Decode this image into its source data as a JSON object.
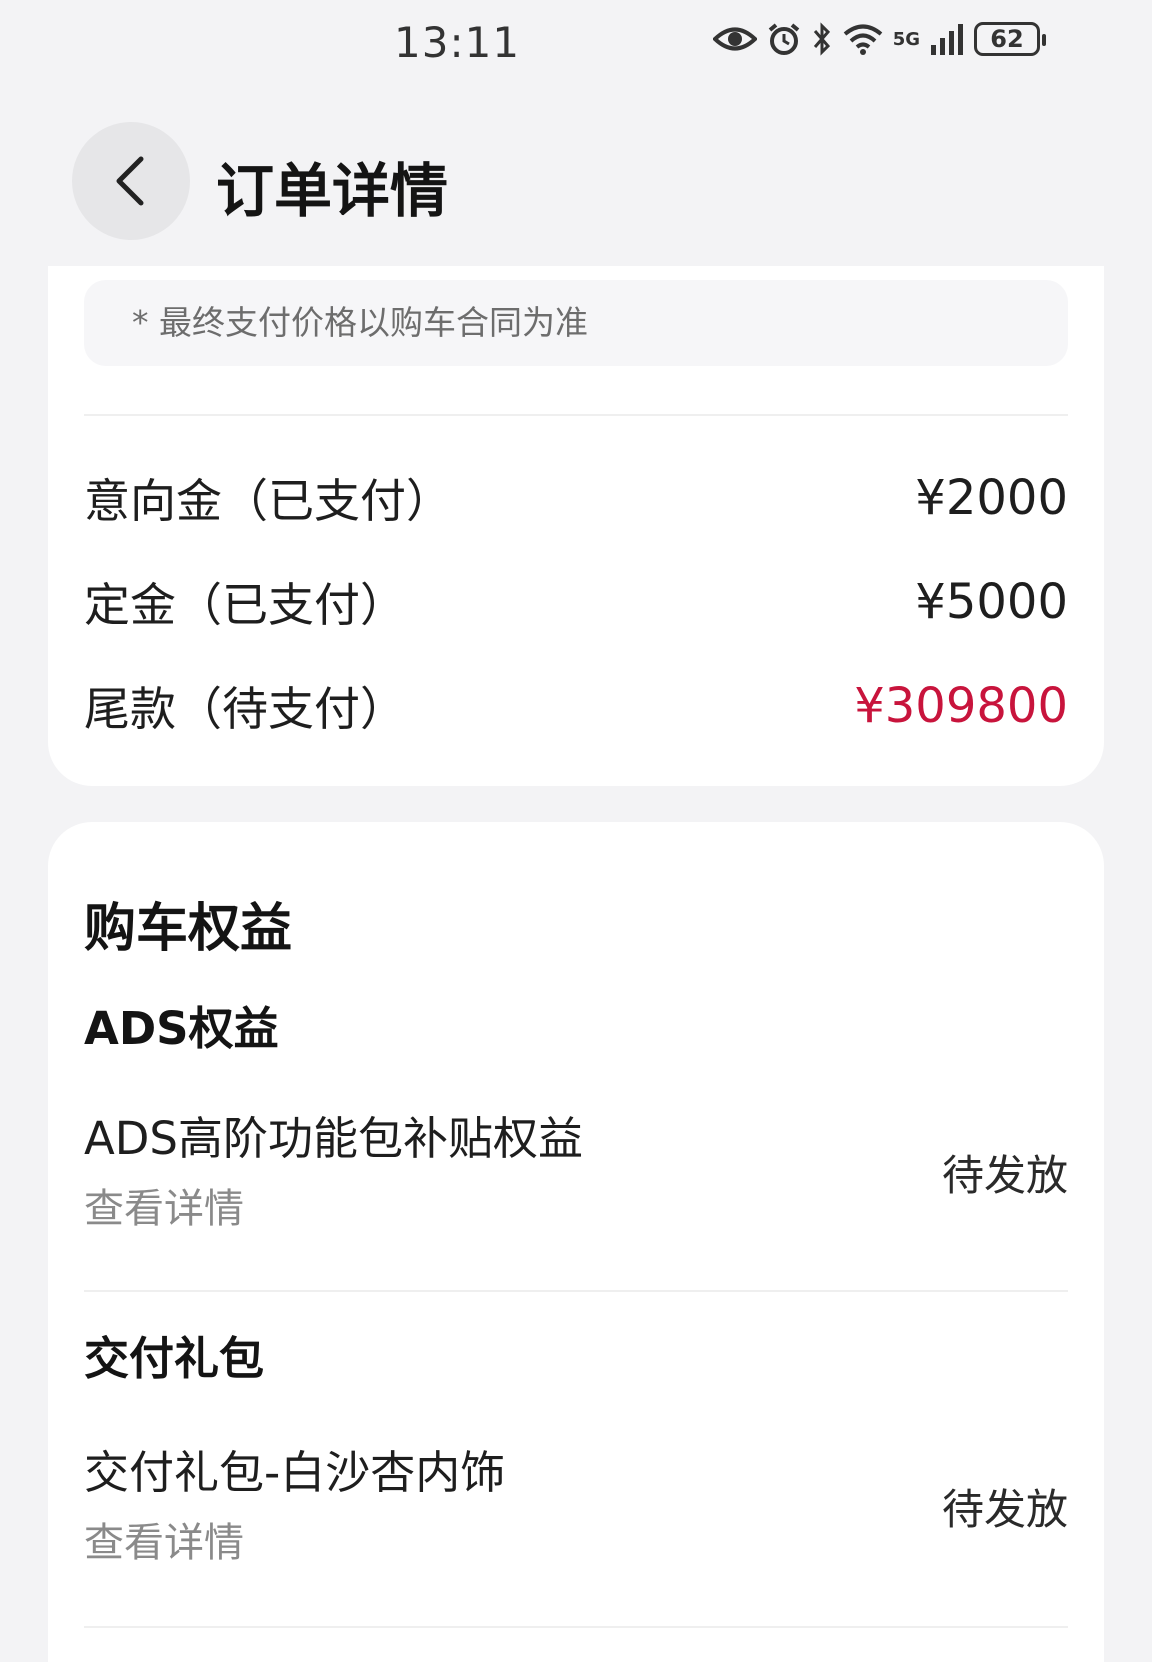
{
  "status_bar": {
    "time": "13:11",
    "network_label": "5G",
    "battery": "62",
    "icons": [
      "eye-icon",
      "alarm-icon",
      "bluetooth-icon",
      "wifi-icon",
      "signal-icon",
      "battery-icon"
    ]
  },
  "header": {
    "back_icon": "chevron-left-icon",
    "title": "订单详情"
  },
  "payment": {
    "notice": "* 最终支付价格以购车合同为准",
    "rows": [
      {
        "label": "意向金（已支付）",
        "amount": "¥2000"
      },
      {
        "label": "定金（已支付）",
        "amount": "¥5000"
      },
      {
        "label": "尾款（待支付）",
        "amount": "¥309800"
      }
    ],
    "due_color": "#c8143c"
  },
  "benefits": {
    "title": "购车权益",
    "groups": [
      {
        "title": "ADS权益",
        "item": {
          "name": "ADS高阶功能包补贴权益",
          "detail_link": "查看详情",
          "status": "待发放"
        }
      },
      {
        "title": "交付礼包",
        "item": {
          "name": "交付礼包-白沙杏内饰",
          "detail_link": "查看详情",
          "status": "待发放"
        }
      }
    ]
  }
}
